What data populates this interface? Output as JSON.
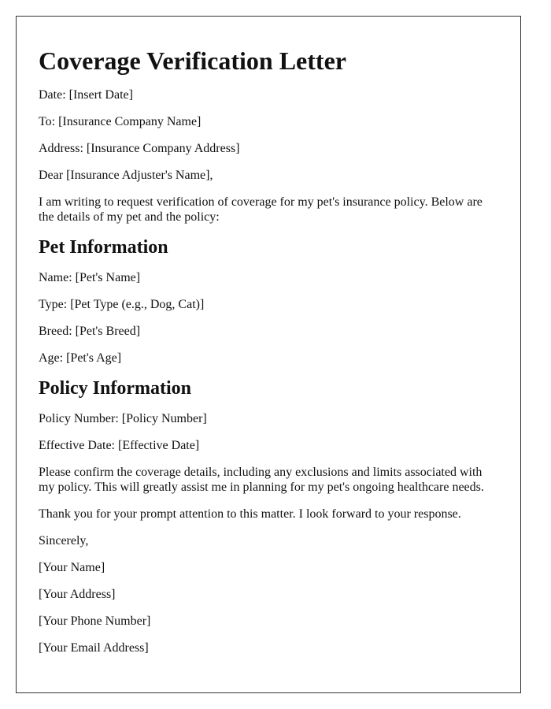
{
  "letter": {
    "title": "Coverage Verification Letter",
    "date": "Date: [Insert Date]",
    "to": "To: [Insurance Company Name]",
    "address": "Address: [Insurance Company Address]",
    "salutation": "Dear [Insurance Adjuster's Name],",
    "intro": "I am writing to request verification of coverage for my pet's insurance policy. Below are the details of my pet and the policy:",
    "pet_section": {
      "heading": "Pet Information",
      "name": "Name: [Pet's Name]",
      "type": "Type: [Pet Type (e.g., Dog, Cat)]",
      "breed": "Breed: [Pet's Breed]",
      "age": "Age: [Pet's Age]"
    },
    "policy_section": {
      "heading": "Policy Information",
      "policy_number": "Policy Number: [Policy Number]",
      "effective_date": "Effective Date: [Effective Date]"
    },
    "request": "Please confirm the coverage details, including any exclusions and limits associated with my policy. This will greatly assist me in planning for my pet's ongoing healthcare needs.",
    "thanks": "Thank you for your prompt attention to this matter. I look forward to your response.",
    "closing": "Sincerely,",
    "signature": {
      "name": "[Your Name]",
      "address": "[Your Address]",
      "phone": "[Your Phone Number]",
      "email": "[Your Email Address]"
    }
  }
}
